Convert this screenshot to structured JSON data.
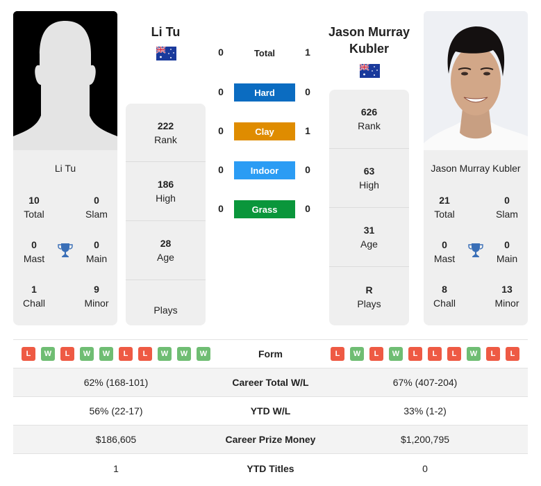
{
  "colors": {
    "hard": "#0b6cc1",
    "clay": "#df8c00",
    "indoor": "#2b9cf4",
    "grass": "#0a963b",
    "loss": "#ee5a44",
    "win": "#6fbd73",
    "trophy": "#3a6fb7"
  },
  "player1": {
    "name": "Li Tu",
    "country_flag": "australia-flag",
    "photo": "silhouette-placeholder",
    "titles": {
      "total": {
        "value": "10",
        "label": "Total"
      },
      "slam": {
        "value": "0",
        "label": "Slam"
      },
      "mast": {
        "value": "0",
        "label": "Mast"
      },
      "main": {
        "value": "0",
        "label": "Main"
      },
      "chall": {
        "value": "1",
        "label": "Chall"
      },
      "minor": {
        "value": "9",
        "label": "Minor"
      }
    },
    "info": [
      {
        "value": "222",
        "label": "Rank"
      },
      {
        "value": "186",
        "label": "High"
      },
      {
        "value": "28",
        "label": "Age"
      },
      {
        "value": "",
        "label": "Plays"
      }
    ]
  },
  "player2": {
    "name": "Jason Murray Kubler",
    "country_flag": "australia-flag",
    "photo": "player-headshot",
    "titles": {
      "total": {
        "value": "21",
        "label": "Total"
      },
      "slam": {
        "value": "0",
        "label": "Slam"
      },
      "mast": {
        "value": "0",
        "label": "Mast"
      },
      "main": {
        "value": "0",
        "label": "Main"
      },
      "chall": {
        "value": "8",
        "label": "Chall"
      },
      "minor": {
        "value": "13",
        "label": "Minor"
      }
    },
    "info": [
      {
        "value": "626",
        "label": "Rank"
      },
      {
        "value": "63",
        "label": "High"
      },
      {
        "value": "31",
        "label": "Age"
      },
      {
        "value": "R",
        "label": "Plays"
      }
    ]
  },
  "h2h": [
    {
      "label": "Total",
      "p1": "0",
      "p2": "1"
    },
    {
      "label": "Hard",
      "p1": "0",
      "p2": "0"
    },
    {
      "label": "Clay",
      "p1": "0",
      "p2": "1"
    },
    {
      "label": "Indoor",
      "p1": "0",
      "p2": "0"
    },
    {
      "label": "Grass",
      "p1": "0",
      "p2": "0"
    }
  ],
  "stats": {
    "form_label": "Form",
    "p1_form": [
      "L",
      "W",
      "L",
      "W",
      "W",
      "L",
      "L",
      "W",
      "W",
      "W"
    ],
    "p2_form": [
      "L",
      "W",
      "L",
      "W",
      "L",
      "L",
      "L",
      "W",
      "L",
      "L"
    ],
    "rows": [
      {
        "label": "Career Total W/L",
        "p1": "62% (168-101)",
        "p2": "67% (407-204)"
      },
      {
        "label": "YTD W/L",
        "p1": "56% (22-17)",
        "p2": "33% (1-2)"
      },
      {
        "label": "Career Prize Money",
        "p1": "$186,605",
        "p2": "$1,200,795"
      },
      {
        "label": "YTD Titles",
        "p1": "1",
        "p2": "0"
      }
    ]
  }
}
